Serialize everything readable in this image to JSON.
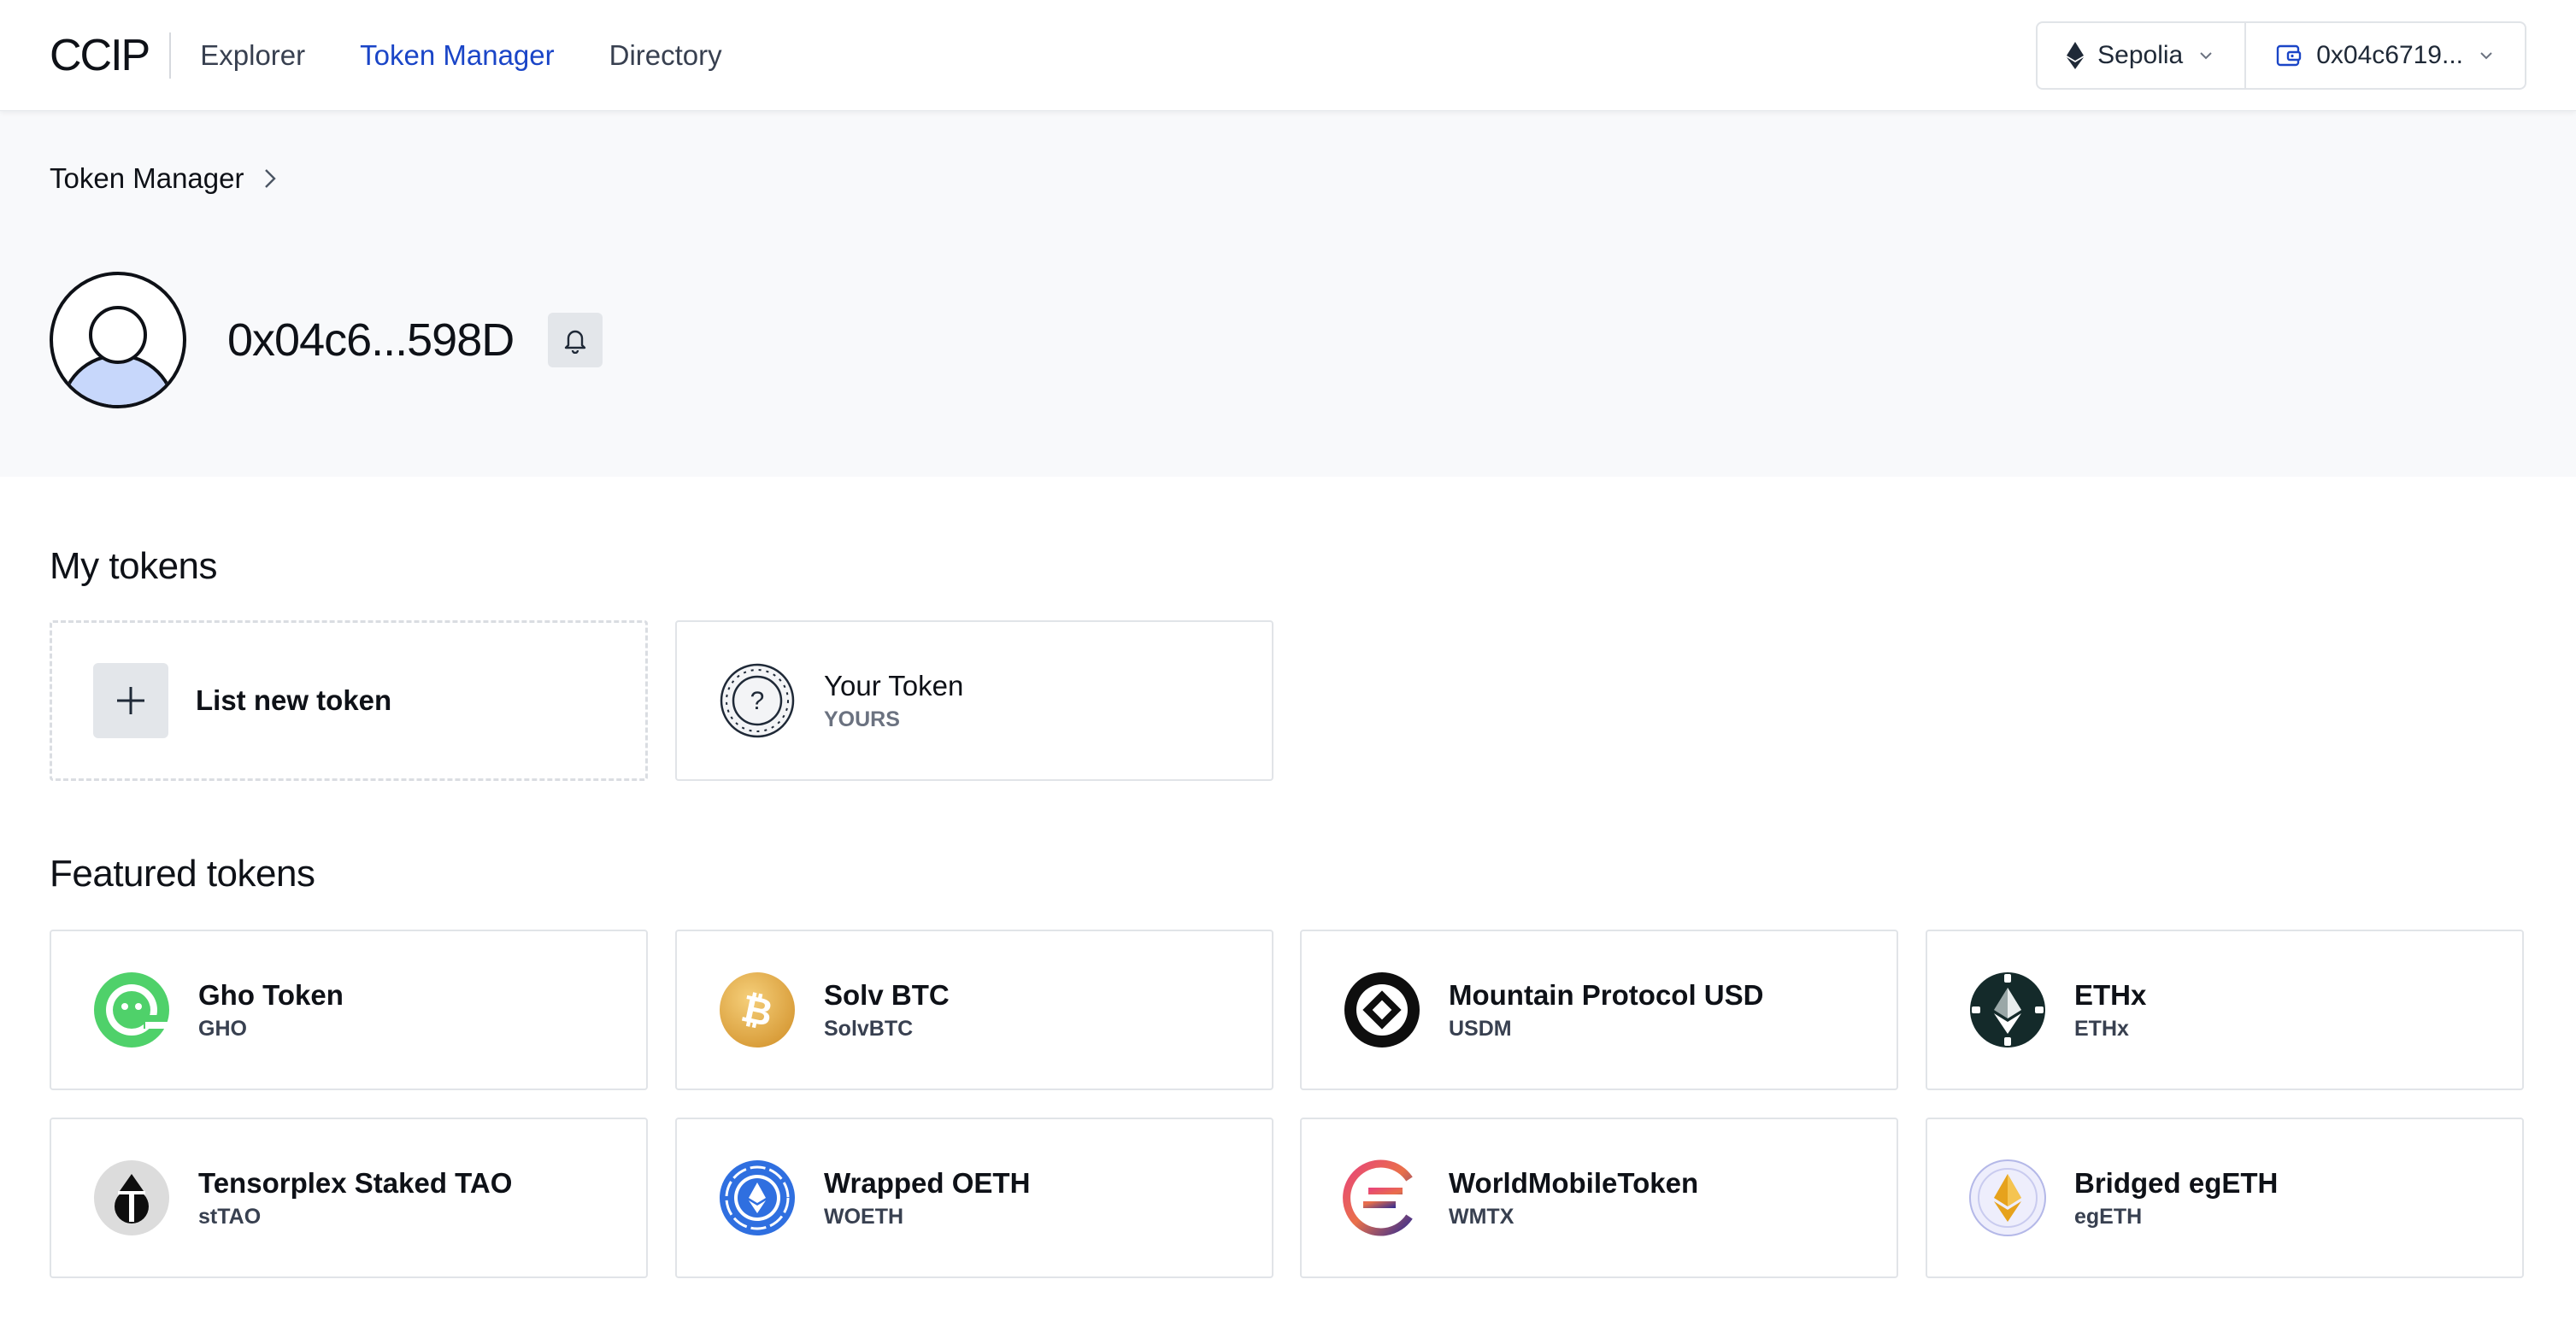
{
  "nav": {
    "logo": "CCIP",
    "links": [
      {
        "label": "Explorer",
        "active": false
      },
      {
        "label": "Token Manager",
        "active": true
      },
      {
        "label": "Directory",
        "active": false
      }
    ],
    "network": {
      "label": "Sepolia",
      "icon": "ethereum-icon"
    },
    "wallet": {
      "label": "0x04c6719...",
      "icon": "wallet-icon"
    },
    "accent_color": "#1a45c7"
  },
  "header": {
    "breadcrumb": "Token Manager",
    "address": "0x04c6...598D"
  },
  "my_tokens": {
    "title": "My tokens",
    "list_new_label": "List new token",
    "tokens": [
      {
        "name": "Your Token",
        "symbol": "YOURS",
        "icon": "unknown-token-icon"
      }
    ]
  },
  "featured": {
    "title": "Featured tokens",
    "tokens": [
      {
        "name": "Gho Token",
        "symbol": "GHO",
        "icon": "gho-icon"
      },
      {
        "name": "Solv BTC",
        "symbol": "SolvBTC",
        "icon": "bitcoin-icon"
      },
      {
        "name": "Mountain Protocol USD",
        "symbol": "USDM",
        "icon": "usdm-icon"
      },
      {
        "name": "ETHx",
        "symbol": "ETHx",
        "icon": "ethx-icon"
      },
      {
        "name": "Tensorplex Staked TAO",
        "symbol": "stTAO",
        "icon": "tao-icon"
      },
      {
        "name": "Wrapped OETH",
        "symbol": "WOETH",
        "icon": "woeth-icon"
      },
      {
        "name": "WorldMobileToken",
        "symbol": "WMTX",
        "icon": "wmtx-icon"
      },
      {
        "name": "Bridged egETH",
        "symbol": "egETH",
        "icon": "egeth-icon"
      }
    ]
  }
}
